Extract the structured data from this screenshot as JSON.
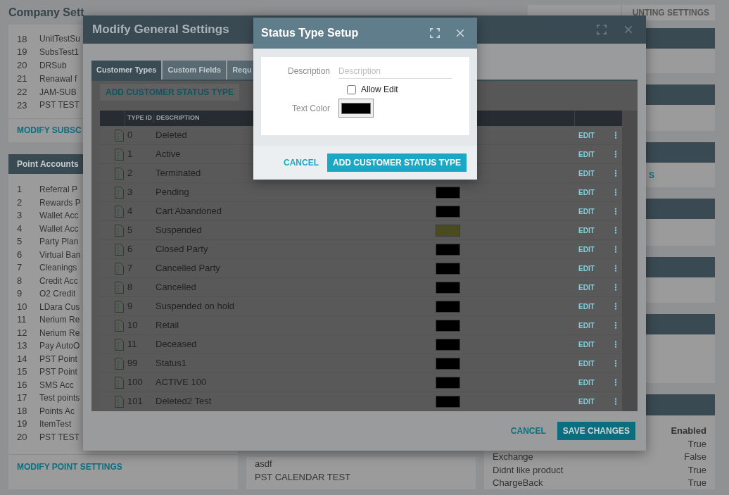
{
  "page": {
    "title": "Company Sett",
    "top_button": "UNTING SETTINGS"
  },
  "subscriptions": {
    "rows": [
      {
        "id": "18",
        "name": "UnitTestSu"
      },
      {
        "id": "19",
        "name": "SubsTest1"
      },
      {
        "id": "20",
        "name": "DRSub"
      },
      {
        "id": "21",
        "name": "Renawal f"
      },
      {
        "id": "22",
        "name": "JAM-SUB"
      },
      {
        "id": "23",
        "name": "PST TEST"
      }
    ],
    "link": "MODIFY SUBSC"
  },
  "point_accounts": {
    "title": "Point Accounts",
    "rows": [
      {
        "id": "1",
        "name": "Referral P"
      },
      {
        "id": "2",
        "name": "Rewards P"
      },
      {
        "id": "3",
        "name": "Wallet Acc"
      },
      {
        "id": "4",
        "name": "Wallet Acc"
      },
      {
        "id": "5",
        "name": "Party Plan"
      },
      {
        "id": "6",
        "name": "Virtual Ban"
      },
      {
        "id": "7",
        "name": "Cleanings"
      },
      {
        "id": "8",
        "name": "Credit Acc"
      },
      {
        "id": "9",
        "name": "O2 Credit"
      },
      {
        "id": "10",
        "name": "LDara Cus"
      },
      {
        "id": "11",
        "name": "Nerium Re"
      },
      {
        "id": "12",
        "name": "Nerium Re"
      },
      {
        "id": "13",
        "name": "Pay AutoO"
      },
      {
        "id": "14",
        "name": "PST Point"
      },
      {
        "id": "15",
        "name": "PST Point"
      },
      {
        "id": "16",
        "name": "SMS Acc"
      },
      {
        "id": "17",
        "name": "Test points"
      },
      {
        "id": "18",
        "name": "Points Ac"
      },
      {
        "id": "19",
        "name": "ItemTest"
      },
      {
        "id": "20",
        "name": "PST TEST"
      }
    ],
    "link": "MODIFY POINT SETTINGS"
  },
  "calendars": {
    "rows": [
      "asdf",
      "PST CALENDAR TEST"
    ]
  },
  "right_panel": {
    "link": "S",
    "table": {
      "header": "Enabled",
      "rows": [
        {
          "name": null,
          "value": "True"
        },
        {
          "name": "Exchange",
          "value": "False"
        },
        {
          "name": "Didnt like product",
          "value": "True"
        },
        {
          "name": "ChargeBack",
          "value": "True"
        }
      ]
    }
  },
  "general_modal": {
    "title": "Modify General Settings",
    "tabs": [
      {
        "label": "Customer Types",
        "selected": true
      },
      {
        "label": "Custom Fields",
        "selected": false
      },
      {
        "label": "Requ",
        "selected": false
      }
    ],
    "add_button": "ADD CUSTOMER STATUS TYPE",
    "columns": [
      "TYPE ID",
      "DESCRIPTION"
    ],
    "rows": [
      {
        "id": "0",
        "description": "Deleted",
        "color": null,
        "action": "EDIT"
      },
      {
        "id": "1",
        "description": "Active",
        "color": null,
        "action": "EDIT"
      },
      {
        "id": "2",
        "description": "Terminated",
        "color": null,
        "action": "EDIT"
      },
      {
        "id": "3",
        "description": "Pending",
        "color": "#000000",
        "action": "EDIT"
      },
      {
        "id": "4",
        "description": "Cart Abandoned",
        "color": "#000000",
        "action": "EDIT"
      },
      {
        "id": "5",
        "description": "Suspended",
        "color": "#4a4b1f",
        "action": "EDIT"
      },
      {
        "id": "6",
        "description": "Closed Party",
        "color": "#000000",
        "action": "EDIT"
      },
      {
        "id": "7",
        "description": "Cancelled Party",
        "color": "#000000",
        "action": "EDIT"
      },
      {
        "id": "8",
        "description": "Cancelled",
        "color": "#000000",
        "action": "EDIT"
      },
      {
        "id": "9",
        "description": "Suspended on hold",
        "color": "#000000",
        "action": "EDIT"
      },
      {
        "id": "10",
        "description": "Retail",
        "color": "#000000",
        "action": "EDIT"
      },
      {
        "id": "11",
        "description": "Deceased",
        "color": "#000000",
        "action": "EDIT"
      },
      {
        "id": "99",
        "description": "Status1",
        "color": "#000000",
        "action": "EDIT"
      },
      {
        "id": "100",
        "description": "ACTIVE 100",
        "color": "#000000",
        "action": "EDIT"
      },
      {
        "id": "101",
        "description": "Deleted2 Test",
        "color": "#000000",
        "action": "EDIT"
      }
    ],
    "cancel": "CANCEL",
    "save": "SAVE CHANGES"
  },
  "status_modal": {
    "title": "Status Type Setup",
    "description": {
      "label": "Description",
      "placeholder": "Description"
    },
    "allow_edit": {
      "label": "Allow Edit",
      "checked": false
    },
    "text_color": {
      "label": "Text Color",
      "color": "#000000"
    },
    "cancel": "CANCEL",
    "submit": "ADD CUSTOMER STATUS TYPE"
  }
}
